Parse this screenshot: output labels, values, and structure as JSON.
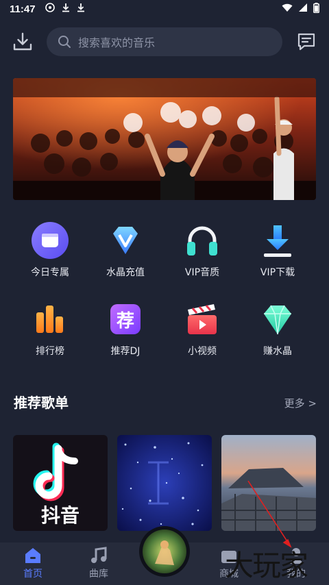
{
  "status": {
    "time": "11:47"
  },
  "search": {
    "placeholder": "搜索喜欢的音乐"
  },
  "quick_grid": [
    {
      "label": "今日专属",
      "icon": "today-exclusive-icon"
    },
    {
      "label": "水晶充值",
      "icon": "crystal-recharge-icon"
    },
    {
      "label": "VIP音质",
      "icon": "headphones-icon"
    },
    {
      "label": "VIP下载",
      "icon": "download-icon"
    },
    {
      "label": "排行榜",
      "icon": "chart-bars-icon"
    },
    {
      "label": "推荐DJ",
      "icon": "recommend-dj-icon"
    },
    {
      "label": "小视频",
      "icon": "video-clapper-icon"
    },
    {
      "label": "赚水晶",
      "icon": "diamond-icon"
    }
  ],
  "section": {
    "title": "推荐歌单",
    "more": "更多 >"
  },
  "playlists": [
    {
      "caption": "抖音"
    },
    {
      "caption": ""
    },
    {
      "caption": ""
    }
  ],
  "bottom_nav": [
    {
      "label": "首页",
      "active": true
    },
    {
      "label": "曲库",
      "active": false
    },
    {
      "label": "商城",
      "active": false
    },
    {
      "label": "我的",
      "active": false
    }
  ],
  "watermark": "大玩家",
  "colors": {
    "background": "#1e2333",
    "accent": "#5a7cff",
    "nav_bg": "#262b3b"
  }
}
